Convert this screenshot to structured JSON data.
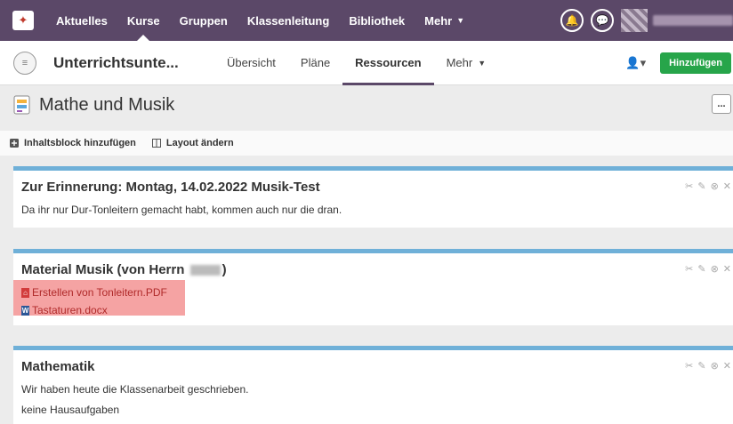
{
  "topnav": {
    "items": [
      "Aktuelles",
      "Kurse",
      "Gruppen",
      "Klassenleitung",
      "Bibliothek",
      "Mehr"
    ],
    "active": "Kurse"
  },
  "subnav": {
    "course_title": "Unterrichtsunte...",
    "tabs": [
      "Übersicht",
      "Pläne",
      "Ressourcen",
      "Mehr"
    ],
    "active": "Ressourcen",
    "add_label": "Hinzufügen"
  },
  "page": {
    "title": "Mathe und Musik",
    "more_label": "...",
    "toolbar": {
      "add_block": "Inhaltsblock hinzufügen",
      "change_layout": "Layout ändern"
    }
  },
  "blocks": [
    {
      "title": "Zur Erinnerung: Montag, 14.02.2022 Musik-Test",
      "lines": [
        "Da ihr nur Dur-Tonleitern gemacht habt, kommen auch nur die dran."
      ]
    },
    {
      "title_prefix": "Material Musik (von Herrn",
      "title_suffix": ")",
      "files": [
        {
          "name": "Erstellen von Tonleitern.PDF",
          "type": "pdf"
        },
        {
          "name": "Tastaturen.docx",
          "type": "word"
        }
      ]
    },
    {
      "title": "Mathematik",
      "lines": [
        "Wir haben heute die Klassenarbeit geschrieben.",
        "keine Hausaufgaben"
      ]
    }
  ],
  "colors": {
    "topbar": "#5b4868",
    "accent_block": "#6fb0d8",
    "add_button": "#27a54a",
    "highlight": "#f5a3a3"
  }
}
